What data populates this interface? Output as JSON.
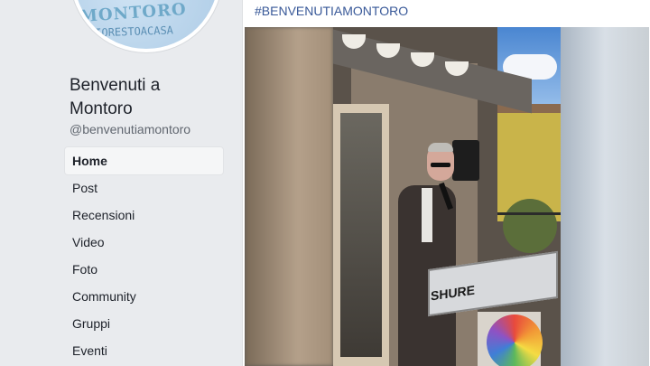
{
  "page": {
    "name": "Benvenuti a Montoro",
    "handle": "@benvenutiamontoro",
    "logo_text": "MONTORO",
    "logo_hashtag": "#IORESTOACASA"
  },
  "nav": {
    "items": [
      {
        "label": "Home",
        "active": true
      },
      {
        "label": "Post",
        "active": false
      },
      {
        "label": "Recensioni",
        "active": false
      },
      {
        "label": "Video",
        "active": false
      },
      {
        "label": "Foto",
        "active": false
      },
      {
        "label": "Community",
        "active": false
      },
      {
        "label": "Gruppi",
        "active": false
      },
      {
        "label": "Eventi",
        "active": false
      }
    ]
  },
  "post": {
    "hashtag": "#BENVENUTIAMONTORO",
    "video_text": "SHURE"
  },
  "colors": {
    "background": "#e9ebee",
    "link": "#385898",
    "text": "#1d2129",
    "secondary": "#616770"
  }
}
